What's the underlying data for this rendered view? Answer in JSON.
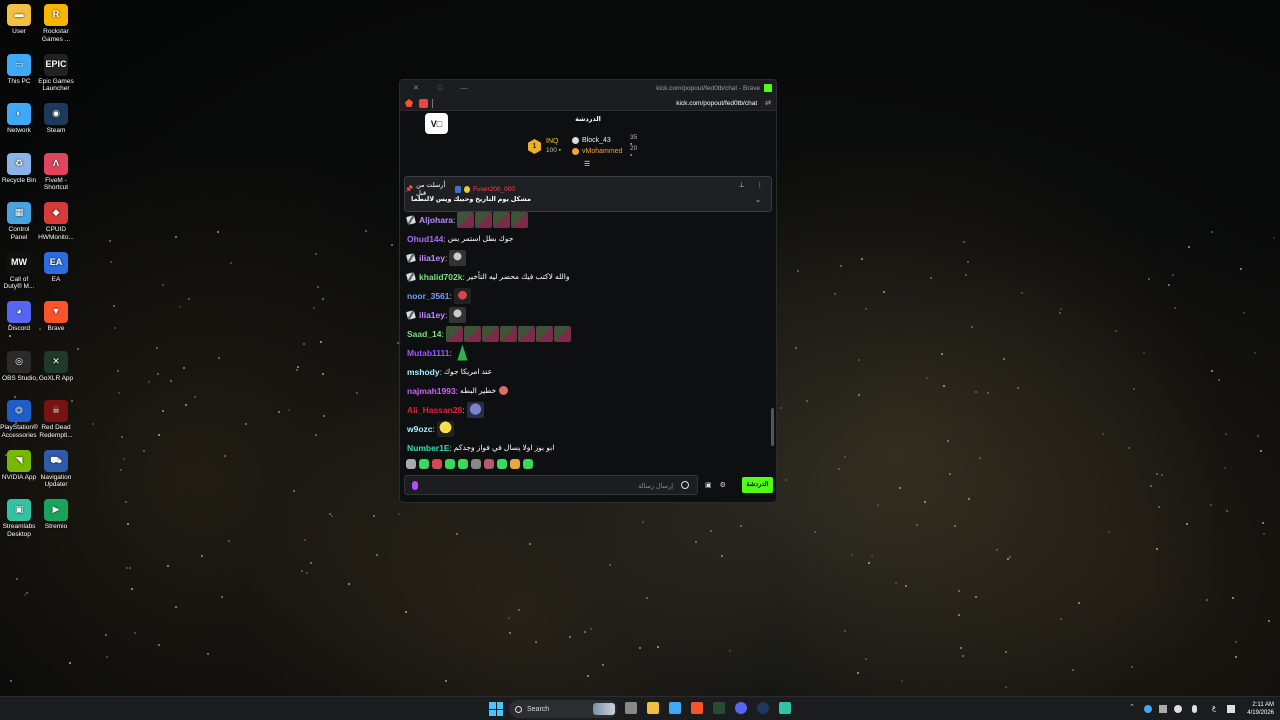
{
  "desktop": {
    "icons": [
      {
        "label": "User",
        "name": "user-folder-icon",
        "color": "#f0c040",
        "glyph": "▬"
      },
      {
        "label": "Rockstar Games ...",
        "name": "rockstar-games-icon",
        "color": "#f7b500",
        "glyph": "R"
      },
      {
        "label": "This PC",
        "name": "this-pc-icon",
        "color": "#3fa9f5",
        "glyph": "▭"
      },
      {
        "label": "Epic Games Launcher",
        "name": "epic-games-icon",
        "color": "#222222",
        "glyph": "EPIC"
      },
      {
        "label": "Network",
        "name": "network-icon",
        "color": "#3fa9f5",
        "glyph": "◐"
      },
      {
        "label": "Steam",
        "name": "steam-icon",
        "color": "#1b3a5c",
        "glyph": "◉"
      },
      {
        "label": "Recycle Bin",
        "name": "recycle-bin-icon",
        "color": "#8ab4e8",
        "glyph": "♻"
      },
      {
        "label": "FiveM - Shortcut",
        "name": "fivem-icon",
        "color": "#e0455d",
        "glyph": "Λ"
      },
      {
        "label": "Control Panel",
        "name": "control-panel-icon",
        "color": "#4aa3df",
        "glyph": "▦"
      },
      {
        "label": "CPUID HWMonito...",
        "name": "cpuid-icon",
        "color": "#d83a3a",
        "glyph": "◆"
      },
      {
        "label": "Call of Duty® M...",
        "name": "call-of-duty-icon",
        "color": "#111111",
        "glyph": "MW"
      },
      {
        "label": "EA",
        "name": "ea-icon",
        "color": "#2c6be0",
        "glyph": "EA"
      },
      {
        "label": "Discord",
        "name": "discord-icon",
        "color": "#5865f2",
        "glyph": "◕"
      },
      {
        "label": "Brave",
        "name": "brave-icon",
        "color": "#fb542b",
        "glyph": "▼"
      },
      {
        "label": "OBS Studio",
        "name": "obs-icon",
        "color": "#2b2b2b",
        "glyph": "◎"
      },
      {
        "label": "GoXLR App",
        "name": "goxlr-icon",
        "color": "#1f3a2a",
        "glyph": "✕"
      },
      {
        "label": "PlayStation® Accessories",
        "name": "playstation-icon",
        "color": "#1f5ec8",
        "glyph": "⏣"
      },
      {
        "label": "Red Dead Redempti...",
        "name": "red-dead-icon",
        "color": "#7a1212",
        "glyph": "☠"
      },
      {
        "label": "NVIDIA App",
        "name": "nvidia-icon",
        "color": "#76b900",
        "glyph": "◥"
      },
      {
        "label": "Navigation Updater",
        "name": "navigation-updater-icon",
        "color": "#2d5ca8",
        "glyph": "⛟"
      },
      {
        "label": "Streamlabs Desktop",
        "name": "streamlabs-icon",
        "color": "#31c3a2",
        "glyph": "▣"
      },
      {
        "label": "Stremio",
        "name": "stremio-icon",
        "color": "#19a35b",
        "glyph": "▶"
      }
    ]
  },
  "browser": {
    "title": "kick.com/popout/fed0tb/chat - Brave",
    "url": "kick.com/popout/fed0tb/chat"
  },
  "chat": {
    "header": "الدردشة",
    "kick_badge": "V□",
    "leaderboard": {
      "top_name": "INQ",
      "top_value": "100",
      "rows": [
        {
          "name": "Block_43",
          "points": "35"
        },
        {
          "name": "vMohammed",
          "points": "20"
        }
      ]
    },
    "pinned": {
      "pinned_by": "أرسلت من قبل",
      "pinned_user": "Fuser200_000",
      "message": "مشكل يوم التاريخ وحبيك ويس لالنطما"
    },
    "messages": [
      {
        "user": "Aljohara",
        "color": "#b98cff",
        "badge": true,
        "text": "",
        "emotes": [
          "pink",
          "pink",
          "pink",
          "pink"
        ]
      },
      {
        "user": "Ohud144",
        "color": "#a86bff",
        "badge": false,
        "text": "جوك بطل استمر بس",
        "emotes": []
      },
      {
        "user": "ilia1ey",
        "color": "#c48dff",
        "badge": true,
        "text": "",
        "emotes": [
          "cat"
        ]
      },
      {
        "user": "khalid702k",
        "color": "#79e07a",
        "badge": true,
        "text": "والله لاكتب فيك محضر ليه التأخير",
        "emotes": []
      },
      {
        "user": "noor_3561",
        "color": "#6aa0ff",
        "badge": false,
        "text": "",
        "emotes": [
          "red"
        ]
      },
      {
        "user": "ilia1ey",
        "color": "#c48dff",
        "badge": true,
        "text": "",
        "emotes": [
          "cat"
        ]
      },
      {
        "user": "Saad_14",
        "color": "#79e07a",
        "badge": false,
        "text": "",
        "emotes": [
          "pink",
          "pink",
          "pink",
          "pink",
          "pink",
          "pink",
          "pink"
        ]
      },
      {
        "user": "Mutab1111",
        "color": "#9b57ff",
        "badge": false,
        "text": "",
        "emotes": [
          "green"
        ]
      },
      {
        "user": "mshody",
        "color": "#a6f0ff",
        "badge": false,
        "text": "عند امريكا جوك",
        "emotes": []
      },
      {
        "user": "najmah1993",
        "color": "#d15dff",
        "badge": false,
        "text": "خطير البطه",
        "emotes": [
          "sm"
        ]
      },
      {
        "user": "Ali_Hassan28",
        "color": "#e0213a",
        "badge": false,
        "text": "",
        "emotes": [
          "blue"
        ]
      },
      {
        "user": "w9ozc",
        "color": "#a6f0ff",
        "badge": false,
        "text": "",
        "emotes": [
          "yel"
        ]
      },
      {
        "user": "Number1E",
        "color": "#2fe0b0",
        "badge": false,
        "text": "ابو بوز اولا يسال في فواز وجدكم",
        "emotes": []
      }
    ],
    "composer_placeholder": "إرسال رسالة",
    "send_label": "الدردشة"
  },
  "taskbar": {
    "search_placeholder": "Search",
    "time": "2:11 AM",
    "date": "4/19/2026",
    "lang": "ع"
  }
}
